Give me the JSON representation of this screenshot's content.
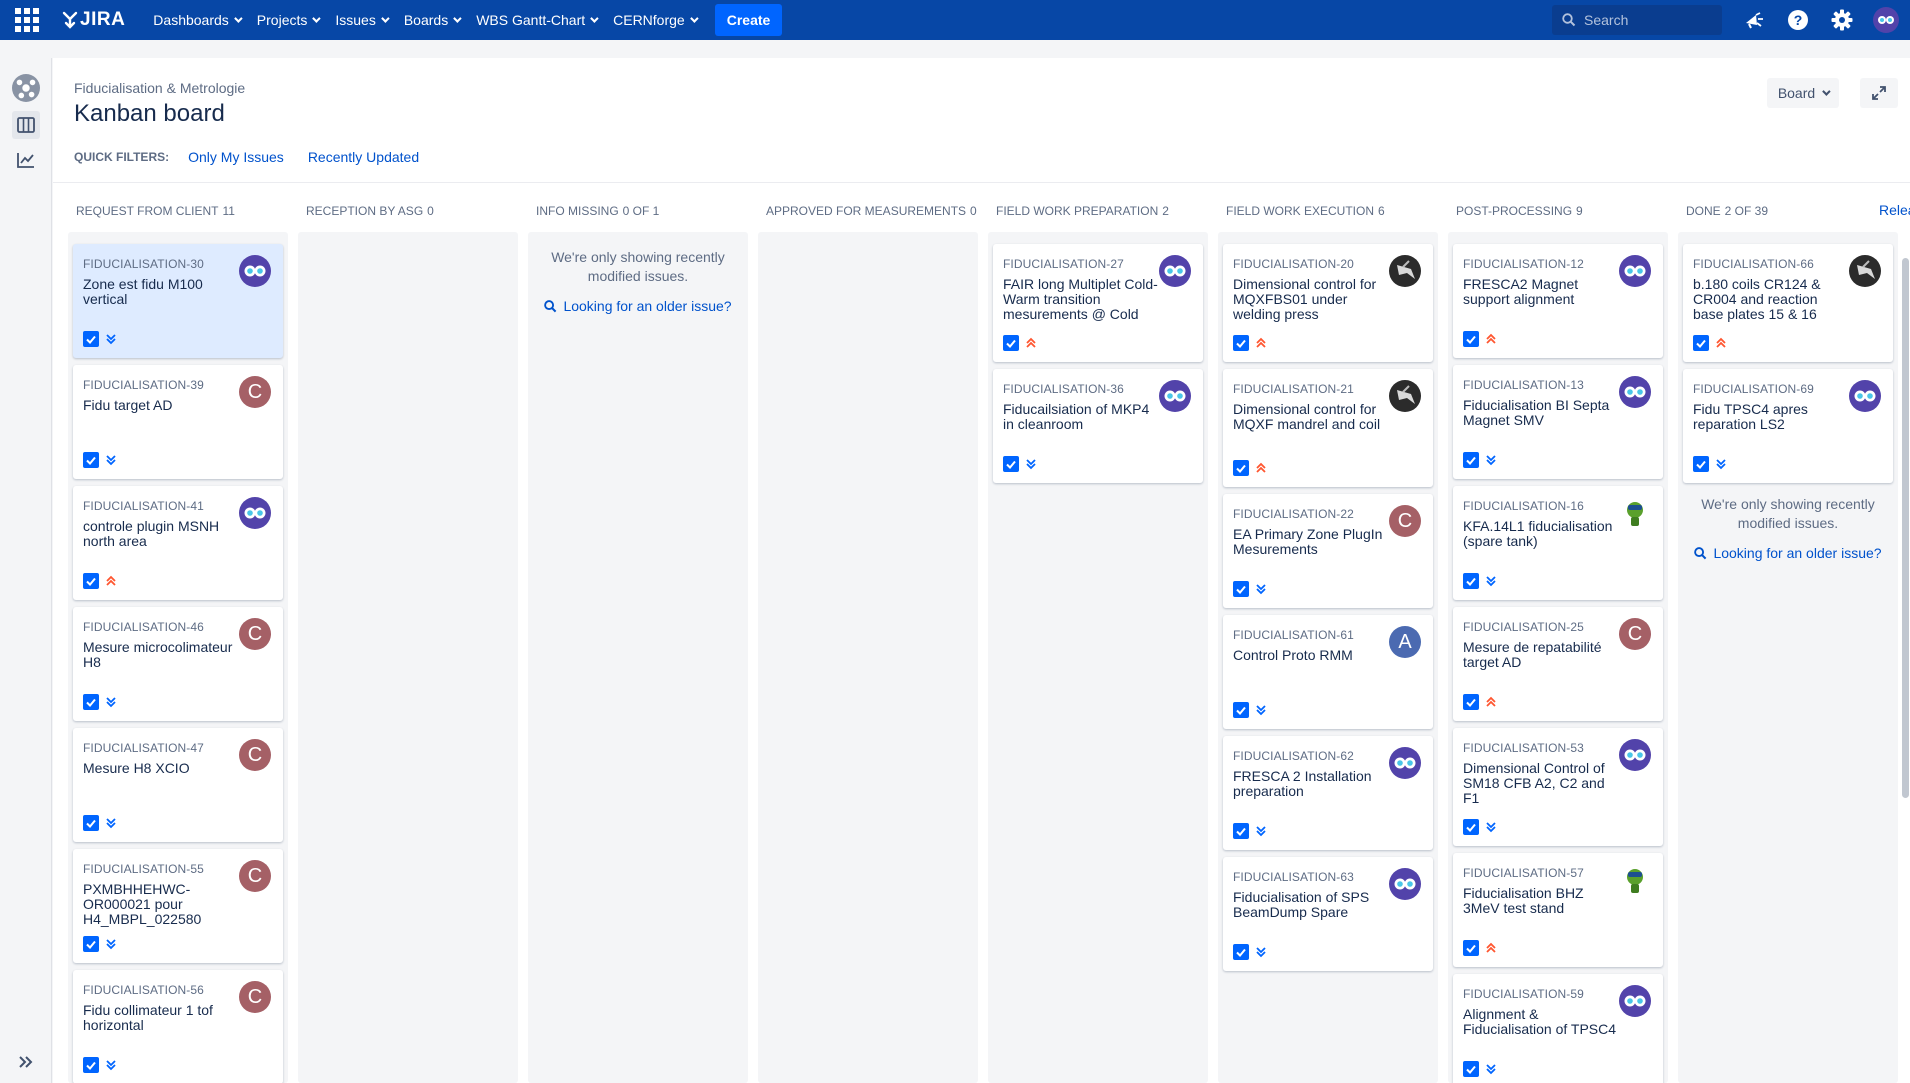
{
  "topnav": {
    "logo": "JIRA",
    "menu": [
      {
        "label": "Dashboards"
      },
      {
        "label": "Projects"
      },
      {
        "label": "Issues"
      },
      {
        "label": "Boards"
      },
      {
        "label": "WBS Gantt-Chart"
      },
      {
        "label": "CERNforge"
      }
    ],
    "create_label": "Create",
    "search_placeholder": "Search"
  },
  "header": {
    "breadcrumb": "Fiducialisation & Metrologie",
    "title": "Kanban board",
    "quick_filters_label": "QUICK FILTERS:",
    "quick_filters": [
      "Only My Issues",
      "Recently Updated"
    ],
    "board_button": "Board"
  },
  "columns": [
    {
      "name": "Request from client",
      "count": "11"
    },
    {
      "name": "Reception by ASG",
      "count": "0"
    },
    {
      "name": "Info missing",
      "count": "0 of 1"
    },
    {
      "name": "Approved for measurements",
      "count": "0"
    },
    {
      "name": "Field work preparation",
      "count": "2"
    },
    {
      "name": "Field work execution",
      "count": "6"
    },
    {
      "name": "Post-processing",
      "count": "9"
    },
    {
      "name": "Done",
      "count": "2 of 39"
    }
  ],
  "release_link": "Release...",
  "empty_notice": {
    "line1": "We're only showing recently",
    "line2": "modified issues.",
    "link": "Looking for an older issue?"
  },
  "cards": {
    "col1": [
      {
        "key": "FIDUCIALISATION-30",
        "summary": "Zone est fidu M100 vertical",
        "avatar": "eye",
        "priority": "low"
      },
      {
        "key": "FIDUCIALISATION-39",
        "summary": "Fidu target AD",
        "avatar": "C",
        "priority": "low"
      },
      {
        "key": "FIDUCIALISATION-41",
        "summary": "controle plugin MSNH north area",
        "avatar": "eye",
        "priority": "high"
      },
      {
        "key": "FIDUCIALISATION-46",
        "summary": "Mesure microcolimateur H8",
        "avatar": "C",
        "priority": "low"
      },
      {
        "key": "FIDUCIALISATION-47",
        "summary": "Mesure H8 XCIO",
        "avatar": "C",
        "priority": "low"
      },
      {
        "key": "FIDUCIALISATION-55",
        "summary": "PXMBHHEHWC-OR000021 pour H4_MBPL_022580",
        "avatar": "C",
        "priority": "low"
      },
      {
        "key": "FIDUCIALISATION-56",
        "summary": "Fidu collimateur 1 tof horizontal",
        "avatar": "C",
        "priority": "low"
      }
    ],
    "col5": [
      {
        "key": "FIDUCIALISATION-27",
        "summary": "FAIR long Multiplet Cold-Warm transition mesurements @ Cold",
        "avatar": "eye",
        "priority": "high"
      },
      {
        "key": "FIDUCIALISATION-36",
        "summary": "Fiducailsiation of MKP4 in cleanroom",
        "avatar": "eye",
        "priority": "low"
      }
    ],
    "col6": [
      {
        "key": "FIDUCIALISATION-20",
        "summary": "Dimensional control for MQXFBS01 under welding press",
        "avatar": "bird",
        "priority": "high"
      },
      {
        "key": "FIDUCIALISATION-21",
        "summary": "Dimensional control for MQXF mandrel and coil",
        "avatar": "bird",
        "priority": "high"
      },
      {
        "key": "FIDUCIALISATION-22",
        "summary": "EA Primary Zone PlugIn Mesurements",
        "avatar": "C",
        "priority": "low"
      },
      {
        "key": "FIDUCIALISATION-61",
        "summary": "Control Proto RMM",
        "avatar": "A",
        "priority": "low"
      },
      {
        "key": "FIDUCIALISATION-62",
        "summary": "FRESCA 2 Installation preparation",
        "avatar": "eye",
        "priority": "low"
      },
      {
        "key": "FIDUCIALISATION-63",
        "summary": "Fiducialisation of SPS BeamDump Spare",
        "avatar": "eye",
        "priority": "low"
      }
    ],
    "col7": [
      {
        "key": "FIDUCIALISATION-12",
        "summary": "FRESCA2 Magnet support alignment",
        "avatar": "eye",
        "priority": "high"
      },
      {
        "key": "FIDUCIALISATION-13",
        "summary": "Fiducialisation BI Septa Magnet SMV",
        "avatar": "eye",
        "priority": "low"
      },
      {
        "key": "FIDUCIALISATION-16",
        "summary": "KFA.14L1 fiducialisation (spare tank)",
        "avatar": "green",
        "priority": "low"
      },
      {
        "key": "FIDUCIALISATION-25",
        "summary": "Mesure de repatabilité target AD",
        "avatar": "C",
        "priority": "high"
      },
      {
        "key": "FIDUCIALISATION-53",
        "summary": "Dimensional Control of SM18 CFB A2, C2 and F1",
        "avatar": "eye",
        "priority": "low"
      },
      {
        "key": "FIDUCIALISATION-57",
        "summary": "Fiducialisation BHZ 3MeV test stand",
        "avatar": "green",
        "priority": "high"
      },
      {
        "key": "FIDUCIALISATION-59",
        "summary": "Alignment & Fiducialisation of TPSC4",
        "avatar": "eye",
        "priority": "low"
      }
    ],
    "col8": [
      {
        "key": "FIDUCIALISATION-66",
        "summary": "b.180 coils CR124 & CR004 and reaction base plates 15 & 16",
        "avatar": "bird",
        "priority": "high"
      },
      {
        "key": "FIDUCIALISATION-69",
        "summary": "Fidu TPSC4 apres reparation LS2",
        "avatar": "eye",
        "priority": "low"
      }
    ]
  },
  "colors": {
    "nav_bg": "#0747a6",
    "create": "#0065ff",
    "link": "#0052cc",
    "priority_high": "#ff5630",
    "priority_low": "#0065ff"
  }
}
